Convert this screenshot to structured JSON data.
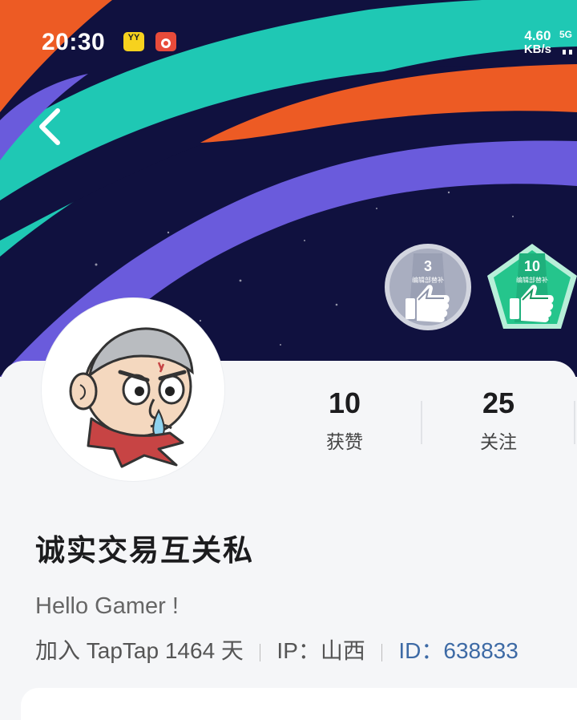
{
  "status_bar": {
    "time": "20:30",
    "net_speed_value": "4.60",
    "net_speed_unit": "KB/s",
    "network_type": "5G",
    "app_icon_yy_text": "YY"
  },
  "badges": [
    {
      "level": "3",
      "caption": "编辑部替补"
    },
    {
      "level": "10",
      "caption": "编辑部替补"
    }
  ],
  "stats": {
    "likes_value": "10",
    "likes_label": "获赞",
    "following_value": "25",
    "following_label": "关注"
  },
  "profile": {
    "username": "诚实交易互关私",
    "bio": "Hello Gamer !",
    "joined": "加入 TapTap 1464 天",
    "ip": "IP：山西",
    "user_id": "ID：638833"
  },
  "colors": {
    "banner_bg": "#10113f",
    "stripe_orange": "#ed5b24",
    "stripe_teal": "#1fc8b4",
    "stripe_purple": "#6a5bdc",
    "badge_silver": "#a9aec0",
    "badge_green": "#25c58c",
    "link_blue": "#3d6aa5"
  },
  "icons": {
    "back": "chevron-left-icon",
    "yy_app": "yy-app-icon",
    "red_app": "red-app-icon",
    "badge": "thumbs-up-icon"
  }
}
